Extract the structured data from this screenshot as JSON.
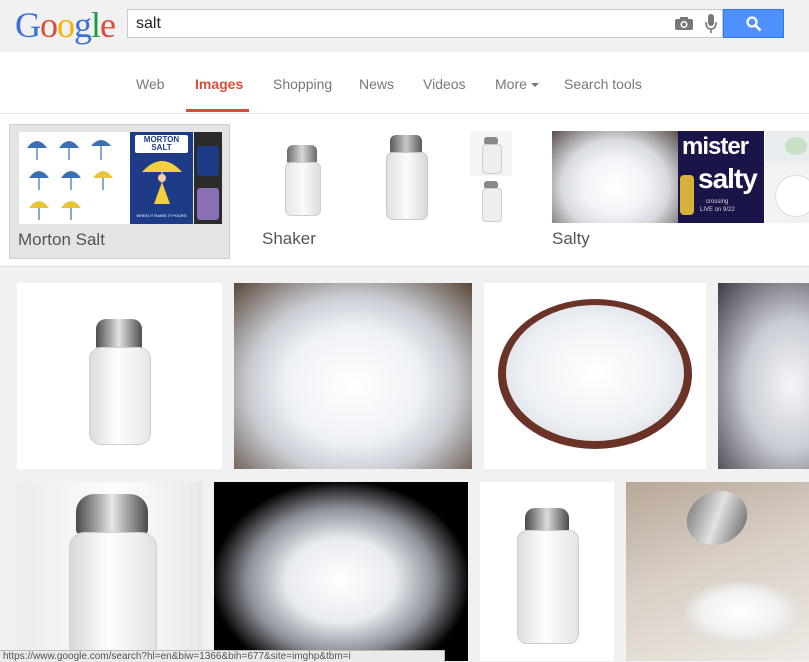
{
  "search": {
    "query": "salt"
  },
  "tabs": [
    {
      "label": "Web"
    },
    {
      "label": "Images"
    },
    {
      "label": "Shopping"
    },
    {
      "label": "News"
    },
    {
      "label": "Videos"
    },
    {
      "label": "More"
    },
    {
      "label": "Search tools"
    }
  ],
  "related": [
    {
      "label": "Morton Salt",
      "brand_top": "MORTON",
      "brand_bottom": "SALT",
      "tagline": "WHEN IT RAINS IT POURS"
    },
    {
      "label": "Shaker"
    },
    {
      "label": "Salty",
      "poster_line1": "mister",
      "poster_line2": "salty",
      "poster_line3": "crossing",
      "poster_line4": "LIVE on 9/22"
    }
  ],
  "status_url": "https://www.google.com/search?hl=en&biw=1366&bih=677&site=imghp&tbm=i",
  "colors": {
    "accent_red": "#dd4b39",
    "search_blue": "#4d90fe"
  }
}
